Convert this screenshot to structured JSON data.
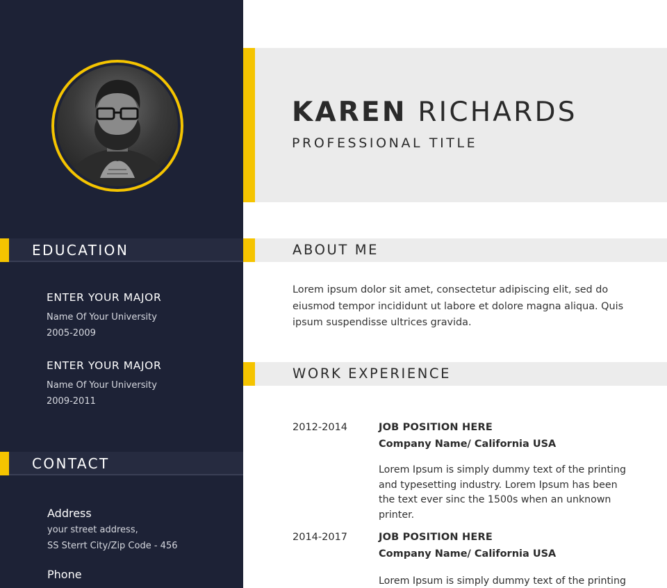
{
  "profile": {
    "first_name": "KAREN",
    "last_name": "RICHARDS",
    "title": "PROFESSIONAL TITLE"
  },
  "sidebar": {
    "education_heading": "EDUCATION",
    "education": [
      {
        "major": "ENTER YOUR MAJOR",
        "university": "Name Of Your University",
        "years": "2005-2009"
      },
      {
        "major": "ENTER YOUR MAJOR",
        "university": "Name Of Your University",
        "years": "2009-2011"
      }
    ],
    "contact_heading": "CONTACT",
    "contact": {
      "address_label": "Address",
      "address_line1": "your street address,",
      "address_line2": "SS Sterrt City/Zip Code - 456",
      "phone_label": "Phone"
    }
  },
  "main": {
    "about_heading": "ABOUT ME",
    "about_text": "Lorem ipsum dolor sit amet, consectetur adipiscing elit, sed do eiusmod tempor incididunt ut labore et dolore magna aliqua. Quis ipsum suspendisse ultrices gravida.",
    "work_heading": "WORK EXPERIENCE",
    "jobs": [
      {
        "years": "2012-2014",
        "position": "JOB POSITION HERE",
        "company": "Company Name/ California USA",
        "description": "Lorem Ipsum is simply dummy text of the printing and typesetting industry. Lorem Ipsum has been the text ever sinc the 1500s when an unknown printer."
      },
      {
        "years": "2014-2017",
        "position": "JOB POSITION HERE",
        "company": "Company Name/ California USA",
        "description": "Lorem Ipsum is simply dummy text of the printing"
      }
    ]
  },
  "colors": {
    "sidebar_bg": "#1d2236",
    "accent": "#f5c400",
    "heading_band": "#ececec",
    "text_dark": "#2a2a2a"
  },
  "icons": {
    "photo": "profile-photo"
  }
}
